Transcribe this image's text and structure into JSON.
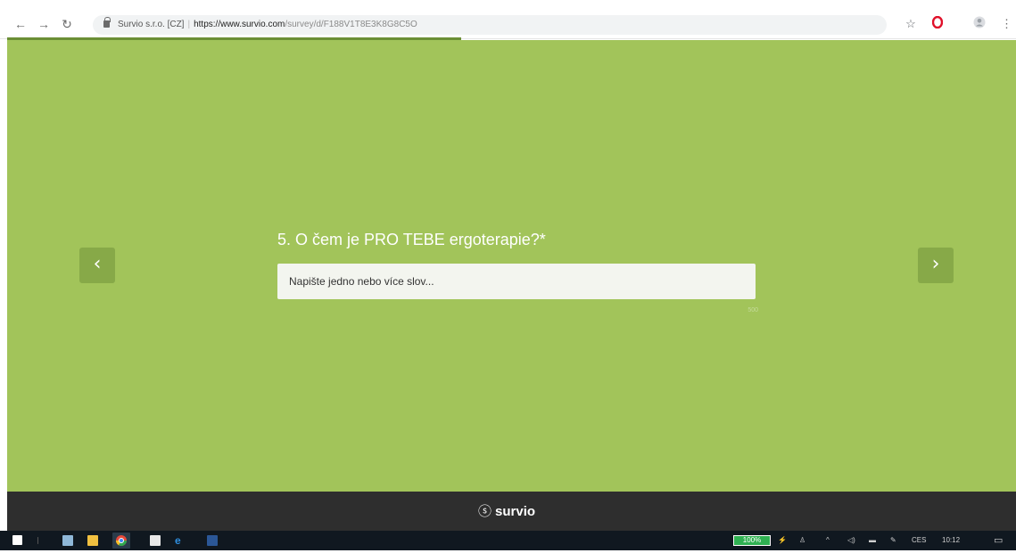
{
  "browser": {
    "back_icon": "back-arrow-icon",
    "forward_icon": "forward-arrow-icon",
    "reload_icon": "reload-icon",
    "site_identity": "Survio s.r.o. [CZ]",
    "url_main": "https://www.survio.com",
    "url_rest": "/survey/d/F188V1T8E3K8G8C5O",
    "bookmark_icon": "star-icon",
    "opera_icon": "opera-icon",
    "profile_icon": "profile-icon",
    "menu_icon": "kebab-menu-icon"
  },
  "survey": {
    "progress": 0.45,
    "prev_label": "‹",
    "next_label": "›",
    "question": "5. O čem je PRO TEBE ergoterapie?*",
    "answer_placeholder": "Napište jedno nebo více slov...",
    "answer_value": "",
    "char_limit": "500",
    "background_color": "#a2c45a",
    "button_color": "#87a948"
  },
  "footer": {
    "brand": "survio",
    "brand_mark": "ఆ"
  },
  "taskbar": {
    "battery": "100%",
    "language": "CES",
    "time": "10:12",
    "icons": [
      "windows-start-icon",
      "app-icon",
      "file-explorer-icon",
      "chrome-icon",
      "store-icon",
      "edge-icon",
      "word-icon"
    ],
    "tray_icons": [
      "plug-icon",
      "people-icon",
      "chevron-up-icon",
      "volume-icon",
      "network-icon",
      "pen-icon",
      "notification-icon"
    ]
  }
}
